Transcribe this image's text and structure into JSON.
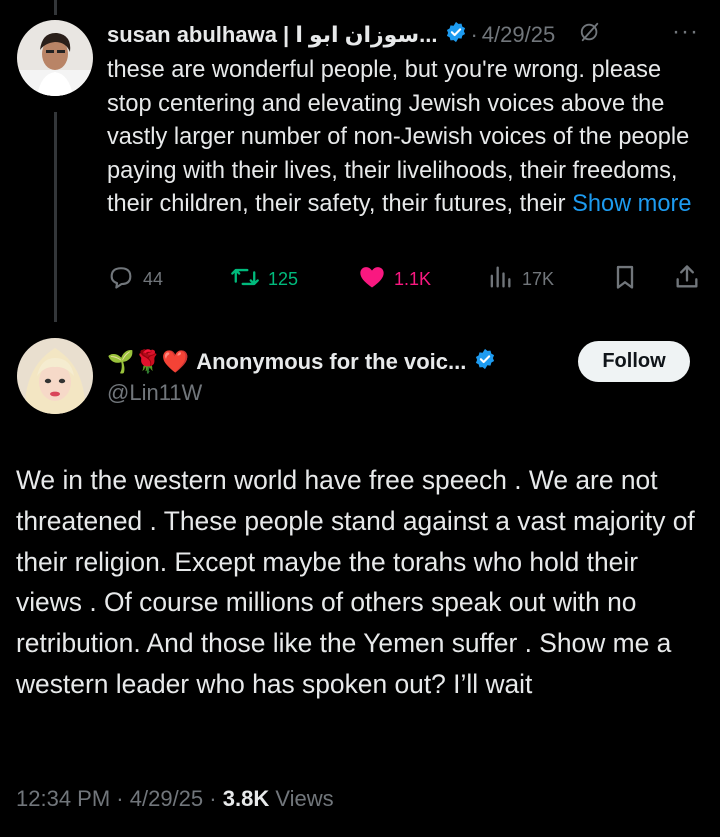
{
  "parent_tweet": {
    "author_name": "susan abulhawa | سوزان ابو ا...",
    "date": "4/29/25",
    "text": "these are wonderful people, but you're wrong. please stop centering and elevating Jewish voices above the vastly larger number of non-Jewish voices of the people paying with their lives, their livelihoods, their freedoms, their children, their safety, their futures, their",
    "show_more": "Show more",
    "replies": "44",
    "reposts": "125",
    "likes": "1.1K",
    "views": "17K",
    "icons": [
      "verified-badge-icon",
      "grok-icon",
      "more-icon",
      "reply-icon",
      "repost-icon",
      "heart-icon",
      "views-icon",
      "bookmark-icon",
      "share-icon"
    ]
  },
  "reply_tweet": {
    "author_emojis": "🌱🌹❤️",
    "author_name": "Anonymous for the voic...",
    "handle": "@Lin11W",
    "follow_label": "Follow",
    "text": "We in the western world have free speech . We are not threatened . These people stand against a vast majority of their religion. Except maybe the torahs who hold their views . Of course millions of others speak out with no retribution. And those like the Yemen suffer . Show me a western leader who has spoken out? I’ll wait",
    "time": "12:34 PM",
    "date": "4/29/25",
    "views_count": "3.8K",
    "views_label": "Views"
  },
  "colors": {
    "background": "#000000",
    "text": "#e7e9ea",
    "muted": "#71767b",
    "link": "#1d9bf0",
    "verified": "#1d9bf0",
    "repost": "#00ba7c",
    "like": "#f91880"
  }
}
